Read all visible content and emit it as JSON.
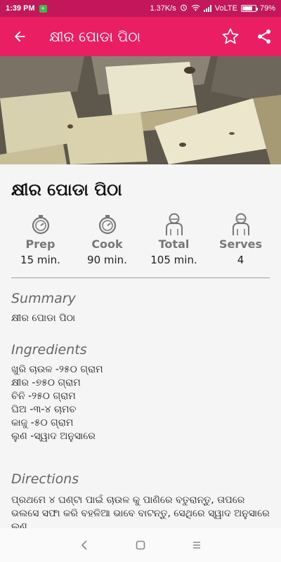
{
  "status": {
    "time": "1:39 PM",
    "notif_icon": "+",
    "speed": "1.37K/s",
    "network": "VoLTE",
    "battery": "79%",
    "battery_level": 0.79
  },
  "appbar": {
    "title": "କ୍ଷୀର ପୋଡା ପିଠା",
    "back_icon": "arrow-left-icon",
    "favorite_icon": "star-outline-icon",
    "share_icon": "share-icon"
  },
  "recipe": {
    "title": "କ୍ଷୀର ପୋଡା ପିଠା",
    "stats": [
      {
        "label": "Prep",
        "value": "15 min.",
        "icon": "timer-icon"
      },
      {
        "label": "Cook",
        "value": "90 min.",
        "icon": "timer-icon"
      },
      {
        "label": "Total",
        "value": "105 min.",
        "icon": "person-icon"
      },
      {
        "label": "Serves",
        "value": "4",
        "icon": "person-icon"
      }
    ],
    "summary_heading": "Summary",
    "summary_text": "କ୍ଷୀର ପୋଡା ପିଠା",
    "ingredients_heading": "Ingredients",
    "ingredients": [
      "ଖୁରି  ଚାଉଳ -୨୫୦ ଗ୍ରାମ",
      "କ୍ଷୀର -୭୫୦ ଗ୍ରାମ",
      "ଚିନି  -୨୫୦ ଗ୍ରାମ",
      "ଘିଅ -୩-୪ ଚାମଚ",
      "କାଜୁ -୫୦ ଗ୍ରାମ",
      "ଲୁଣ -ସ୍ୱାଦ ଅନୁସାରେ"
    ],
    "directions_heading": "Directions",
    "directions_text": "ପ୍ରଥମେ ୪ ଘଣ୍ଟା ପାଇଁ ଚାଉଳ କୁ ପାଣିରେ ବତୁରାନ୍ତୁ, ତାପରେ ଭଲସେ ସଫା କରି ବହଳିଆ ଭାବେ ବାଟନ୍ତୁ, ସେଥିରେ ସ୍ୱାଦ ଅନୁସାରେ ଲୁଣ"
  },
  "navbar": {
    "back_icon": "nav-back-icon",
    "home_icon": "nav-home-icon",
    "menu_icon": "nav-menu-icon"
  },
  "colors": {
    "statusbar": "#c2185b",
    "appbar": "#e91e63"
  }
}
